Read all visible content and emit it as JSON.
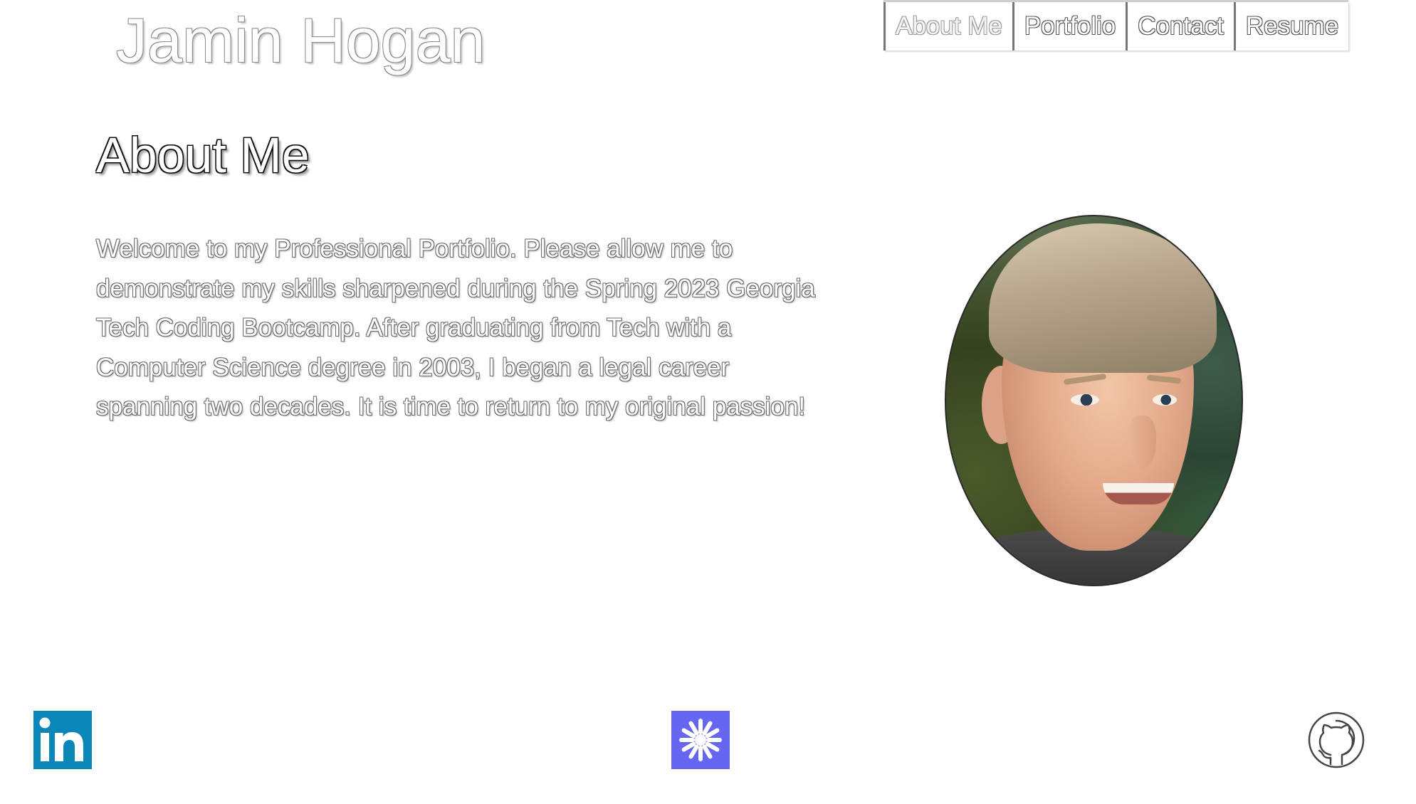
{
  "header": {
    "site_title": "Jamin Hogan"
  },
  "nav": {
    "items": [
      {
        "label": "About Me",
        "active": true
      },
      {
        "label": "Portfolio",
        "active": false
      },
      {
        "label": "Contact",
        "active": false
      },
      {
        "label": "Resume",
        "active": false
      }
    ]
  },
  "main": {
    "heading": "About Me",
    "bio": "Welcome to my Professional Portfolio. Please allow me to demonstrate my skills sharpened during the Spring 2023 Georgia Tech Coding Bootcamp. After graduating from Tech with a Computer Science degree in 2003, I began a legal career spanning two decades. It is time to return to my original passion!",
    "photo_alt": "profile-photo"
  },
  "footer": {
    "icons": [
      {
        "name": "linkedin-icon",
        "color": "#0b86b8"
      },
      {
        "name": "asterisk-icon",
        "color": "#6466f1"
      },
      {
        "name": "github-icon",
        "color": "#333333"
      }
    ]
  },
  "colors": {
    "background": "#ffffff",
    "nav_border": "#777777",
    "linkedin_blue": "#0b86b8",
    "accent_purple": "#6466f1"
  }
}
